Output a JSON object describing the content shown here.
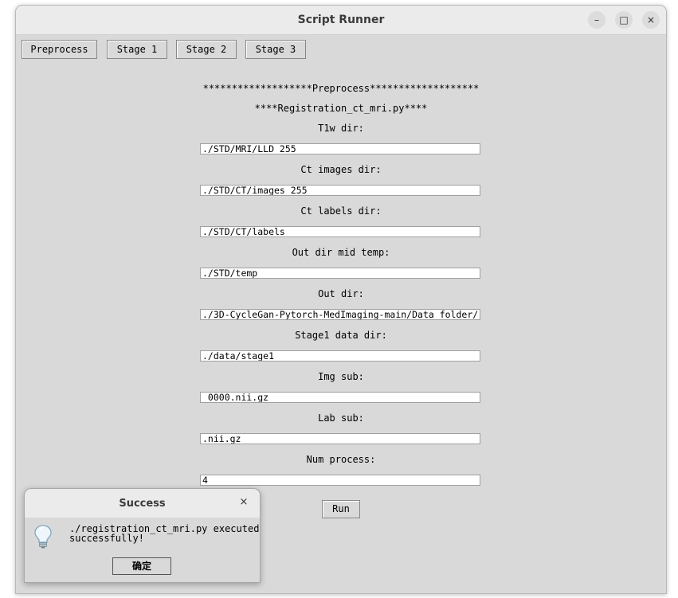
{
  "window": {
    "title": "Script Runner"
  },
  "window_controls": {
    "minimize": "–",
    "maximize": "□",
    "close": "×"
  },
  "tabs": [
    {
      "label": "Preprocess"
    },
    {
      "label": "Stage 1"
    },
    {
      "label": "Stage 2"
    },
    {
      "label": "Stage 3"
    }
  ],
  "form": {
    "header": "*******************Preprocess*******************",
    "script_name": "****Registration_ct_mri.py****",
    "fields": [
      {
        "label": "T1w dir:",
        "value": "./STD/MRI/LLD_255"
      },
      {
        "label": "Ct images dir:",
        "value": "./STD/CT/images_255"
      },
      {
        "label": "Ct labels dir:",
        "value": "./STD/CT/labels"
      },
      {
        "label": "Out dir mid temp:",
        "value": "./STD/temp"
      },
      {
        "label": "Out dir:",
        "value": "./3D-CycleGan-Pytorch-MedImaging-main/Data_folder/"
      },
      {
        "label": "Stage1 data dir:",
        "value": "./data/stage1"
      },
      {
        "label": "Img sub:",
        "value": "_0000.nii.gz"
      },
      {
        "label": "Lab sub:",
        "value": ".nii.gz"
      },
      {
        "label": "Num process:",
        "value": "4"
      }
    ],
    "run_label": "Run"
  },
  "dialog": {
    "title": "Success",
    "close": "×",
    "icon": "lightbulb-icon",
    "message": "./registration_ct_mri.py executed\nsuccessfully!",
    "ok_label": "确定"
  },
  "colors": {
    "window_bg": "#d9d9d9",
    "titlebar_bg": "#ebebeb",
    "field_bg": "#ffffff"
  }
}
